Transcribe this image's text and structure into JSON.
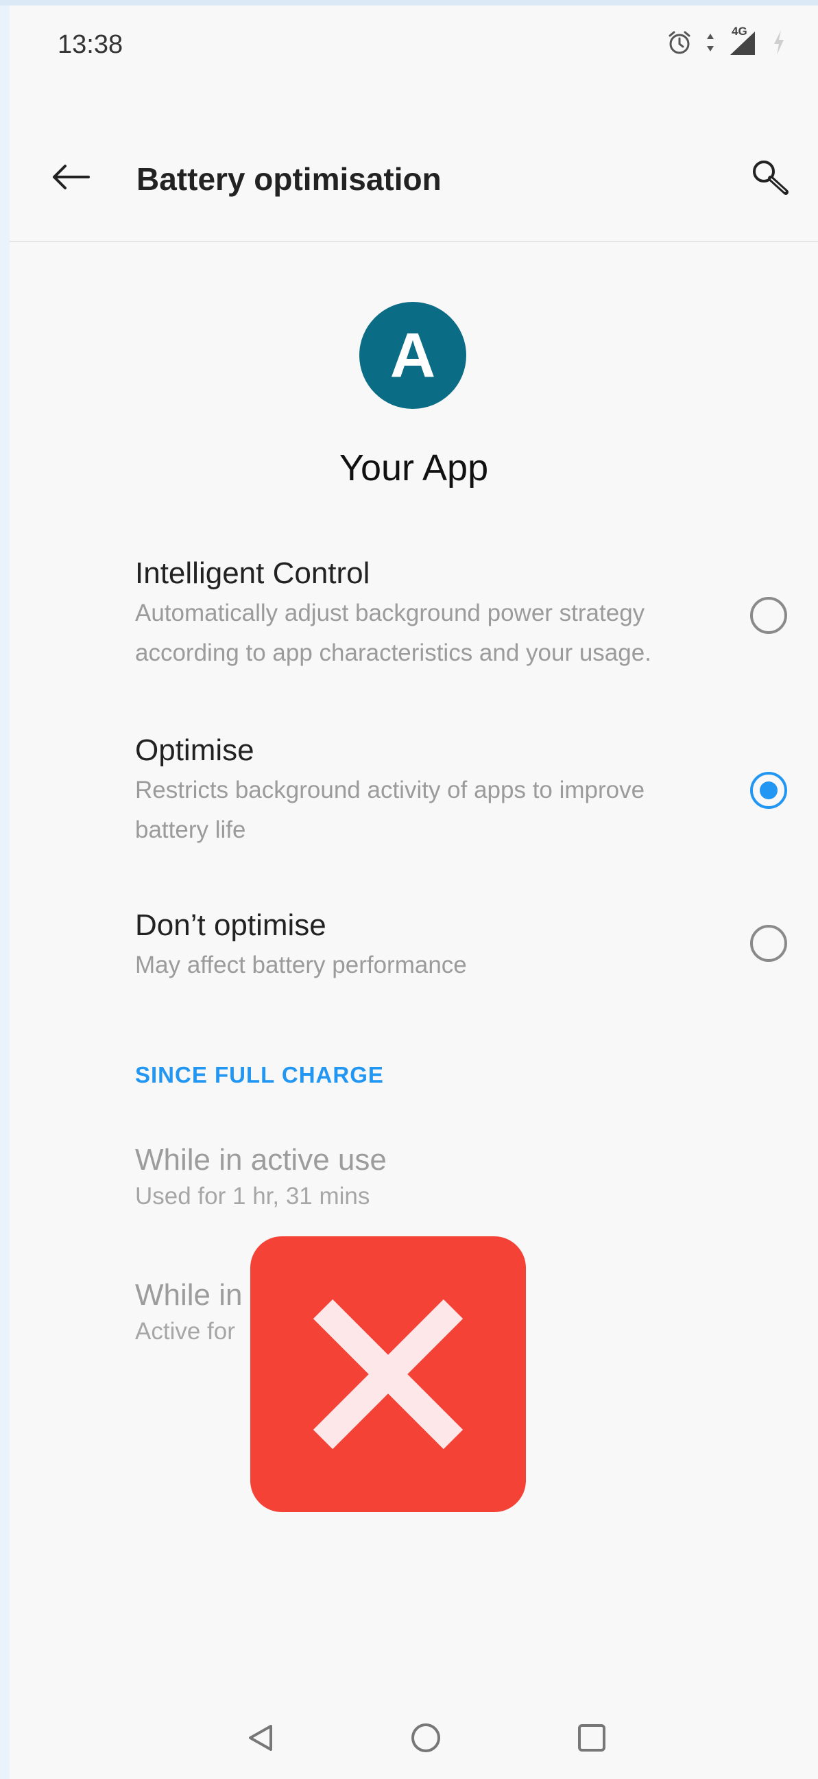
{
  "status_bar": {
    "time": "13:38",
    "network_label": "4G",
    "icons": [
      "alarm-icon",
      "data-arrows-icon",
      "signal-icon",
      "battery-charging-icon"
    ]
  },
  "app_bar": {
    "title": "Battery optimisation",
    "back_icon": "arrow-left-icon",
    "search_icon": "search-icon"
  },
  "app": {
    "initial": "A",
    "name": "Your App",
    "avatar_color": "#0b6c86"
  },
  "options": [
    {
      "title": "Intelligent Control",
      "desc_lines": [
        "Automatically adjust background power strategy",
        "according to app characteristics and your usage."
      ],
      "selected": false
    },
    {
      "title": "Optimise",
      "desc_lines": [
        "Restricts background activity of apps to improve",
        "battery life"
      ],
      "selected": true
    },
    {
      "title": "Don’t optimise",
      "desc_lines": [
        "May affect battery performance"
      ],
      "selected": false
    }
  ],
  "section": {
    "header": "SINCE FULL CHARGE"
  },
  "usage": [
    {
      "title": "While in active use",
      "desc": "Used for 1 hr, 31 mins"
    },
    {
      "title": "While in",
      "desc": "Active for"
    }
  ],
  "overlay": {
    "icon": "close-icon",
    "color": "#f44236"
  },
  "nav": {
    "icons": [
      "nav-back-icon",
      "nav-home-icon",
      "nav-recents-icon"
    ]
  },
  "colors": {
    "accent": "#2196f3",
    "background": "#f8f8f8"
  }
}
